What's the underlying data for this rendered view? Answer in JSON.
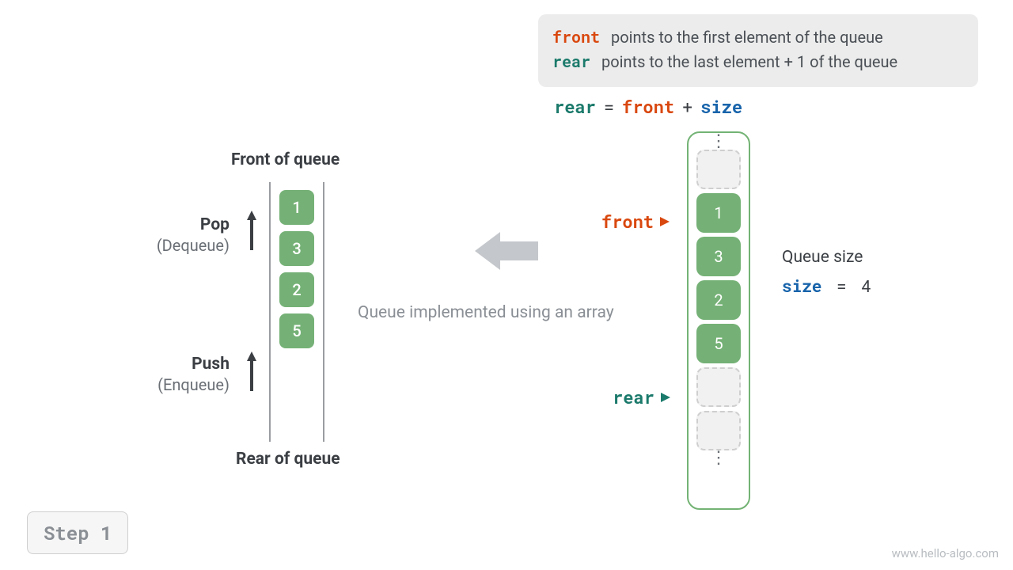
{
  "definitions": {
    "front_kw": "front",
    "front_desc": "points to the first element of the queue",
    "rear_kw": "rear",
    "rear_desc": "points to the last element + 1 of the queue"
  },
  "equation": {
    "rear": "rear",
    "eq": "=",
    "front": "front",
    "plus": "+",
    "size": "size"
  },
  "left": {
    "front_label": "Front of queue",
    "rear_label": "Rear of queue",
    "pop_title": "Pop",
    "pop_sub": "(Dequeue)",
    "push_title": "Push",
    "push_sub": "(Enqueue)",
    "cells": [
      "1",
      "3",
      "2",
      "5"
    ]
  },
  "caption": "Queue implemented using an array",
  "array": {
    "slots": [
      {
        "type": "empty"
      },
      {
        "type": "filled",
        "value": "1"
      },
      {
        "type": "filled",
        "value": "3"
      },
      {
        "type": "filled",
        "value": "2"
      },
      {
        "type": "filled",
        "value": "5"
      },
      {
        "type": "empty"
      },
      {
        "type": "empty"
      }
    ],
    "front_ptr": "front",
    "rear_ptr": "rear"
  },
  "size": {
    "label": "Queue size",
    "size_kw": "size",
    "eq": "=",
    "value": "4"
  },
  "step": "Step 1",
  "watermark": "www.hello-algo.com"
}
